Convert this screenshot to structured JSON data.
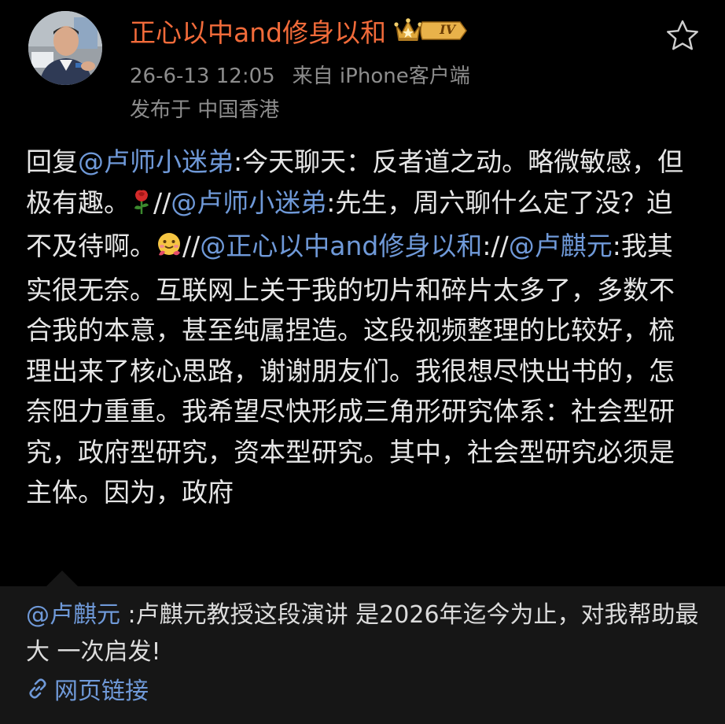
{
  "post": {
    "author": {
      "name": "正心以中and修身以和",
      "level_badge": "IV",
      "avatar_icon": "user-avatar"
    },
    "meta": {
      "timestamp": "26-6-13 12:05",
      "source": "来自 iPhone客户端",
      "location": "发布于 中国香港"
    },
    "favorite_icon": "star-outline-icon",
    "body": {
      "s1": "回复",
      "m1": "@卢师小迷弟",
      "s2": ":今天聊天：反者道之动。略微敏感，但极有趣。",
      "emoji1": "rose-emoji",
      "s3": "//",
      "m2": "@卢师小迷弟",
      "s4": ":先生，周六聊什么定了没？迫不及待啊。",
      "emoji2": "hug-face-emoji",
      "s5": "//",
      "m3": "@正心以中and修身以和",
      "s6": "://",
      "m4": "@卢麒元",
      "s7": ":我其实很无奈。互联网上关于我的切片和碎片太多了，多数不合我的本意，甚至纯属捏造。这段视频整理的比较好，梳理出来了核心思路，谢谢朋友们。我很想尽快出书的，怎奈阻力重重。我希望尽快形成三角形研究体系：社会型研究，政府型研究，资本型研究。其中，社会型研究必须是主体。因为，政府"
    }
  },
  "quote": {
    "mention": "@卢麒元",
    "text": " :卢麒元教授这段演讲 是2026年迄今为止，对我帮助最大 一次启发!",
    "link_label": "网页链接",
    "link_icon": "link-icon"
  },
  "colors": {
    "background": "#000000",
    "author_name": "#f26b3a",
    "mention": "#6f99d8",
    "meta_text": "#8d8d8d",
    "body_text": "#e6e6e6",
    "quote_background": "#161616"
  }
}
